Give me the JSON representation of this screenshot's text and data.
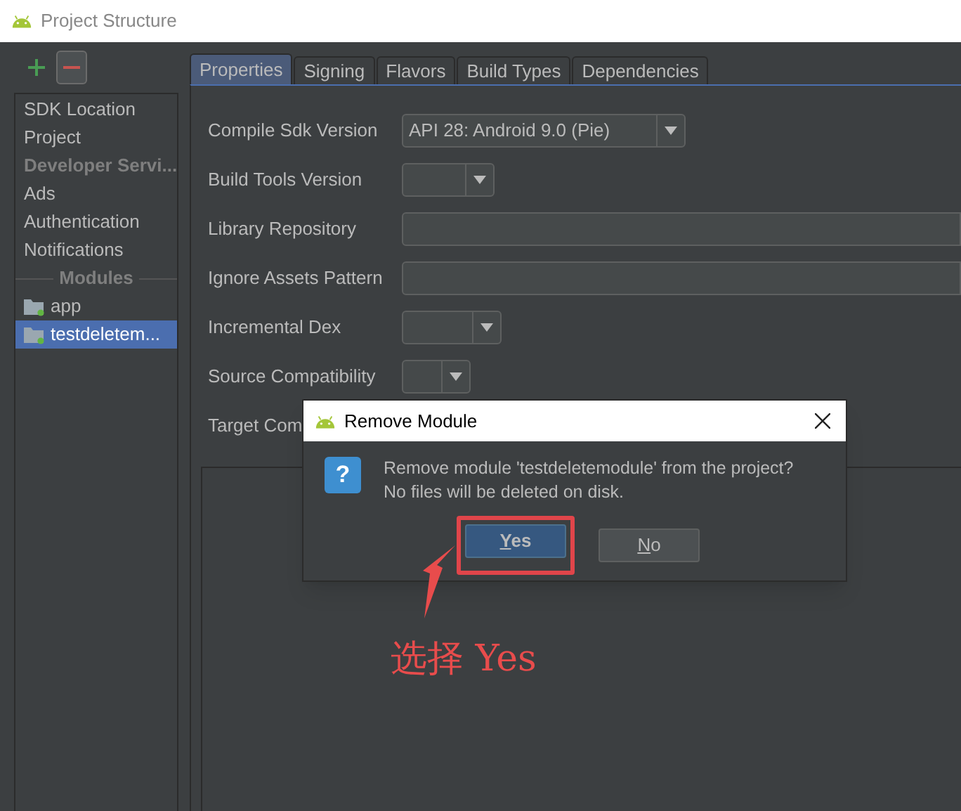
{
  "window": {
    "title": "Project Structure"
  },
  "sidebar": {
    "items": [
      {
        "label": "SDK Location",
        "kind": "item",
        "selected": false
      },
      {
        "label": "Project",
        "kind": "item",
        "selected": false
      },
      {
        "label": "Developer Servi...",
        "kind": "header",
        "selected": false
      },
      {
        "label": "Ads",
        "kind": "item",
        "selected": false
      },
      {
        "label": "Authentication",
        "kind": "item",
        "selected": false
      },
      {
        "label": "Notifications",
        "kind": "item",
        "selected": false
      },
      {
        "label": "Modules",
        "kind": "separator",
        "selected": false
      },
      {
        "label": "app",
        "kind": "module",
        "selected": false
      },
      {
        "label": "testdeletem...",
        "kind": "module",
        "selected": true
      }
    ]
  },
  "tabs": [
    {
      "label": "Properties",
      "selected": true
    },
    {
      "label": "Signing",
      "selected": false
    },
    {
      "label": "Flavors",
      "selected": false
    },
    {
      "label": "Build Types",
      "selected": false
    },
    {
      "label": "Dependencies",
      "selected": false
    }
  ],
  "form": [
    {
      "label": "Compile Sdk Version",
      "kind": "combo",
      "value": "API 28: Android 9.0 (Pie)"
    },
    {
      "label": "Build Tools Version",
      "kind": "combo"
    },
    {
      "label": "Library Repository",
      "kind": "text"
    },
    {
      "label": "Ignore Assets Pattern",
      "kind": "text"
    },
    {
      "label": "Incremental Dex",
      "kind": "combo"
    },
    {
      "label": "Source Compatibility",
      "kind": "combo"
    },
    {
      "label": "Target Com",
      "kind": "hidden"
    }
  ],
  "dialog": {
    "title": "Remove Module",
    "icon": "?",
    "message": "Remove module 'testdeletemodule' from the project?",
    "note": "No files will be deleted on disk.",
    "buttons": [
      {
        "label": "Yes",
        "selected": true
      },
      {
        "label": "No",
        "selected": false
      }
    ]
  },
  "annotation": {
    "text": "选择 Yes"
  }
}
